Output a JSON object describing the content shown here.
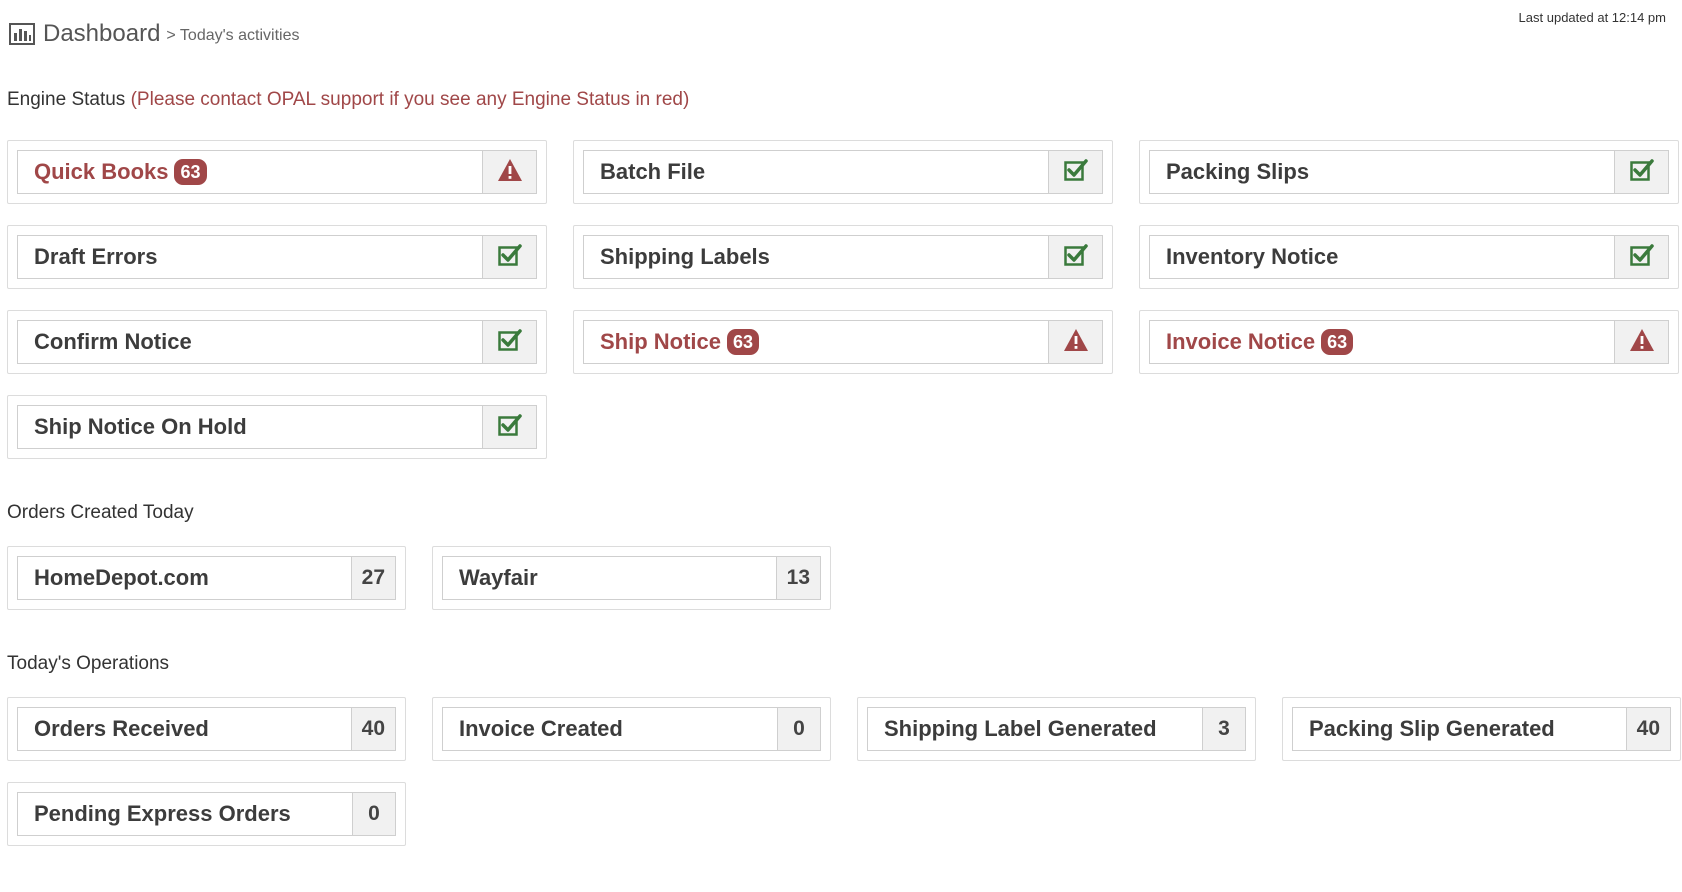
{
  "header": {
    "title": "Dashboard",
    "breadcrumb": "> Today's activities",
    "icon": "bar-chart-icon",
    "last_updated": "Last updated at 12:14 pm"
  },
  "colors": {
    "error": "#a04748",
    "ok": "#3a7a3c",
    "badge": "#a04748"
  },
  "engine_status": {
    "title": "Engine Status",
    "note": "(Please contact OPAL support if you see any Engine Status in red)",
    "items": [
      {
        "label": "Quick Books",
        "badge": "63",
        "status": "error",
        "icon": "warning-icon"
      },
      {
        "label": "Batch File",
        "badge": "",
        "status": "ok",
        "icon": "check-square-icon"
      },
      {
        "label": "Packing Slips",
        "badge": "",
        "status": "ok",
        "icon": "check-square-icon"
      },
      {
        "label": "Draft Errors",
        "badge": "",
        "status": "ok",
        "icon": "check-square-icon"
      },
      {
        "label": "Shipping Labels",
        "badge": "",
        "status": "ok",
        "icon": "check-square-icon"
      },
      {
        "label": "Inventory Notice",
        "badge": "",
        "status": "ok",
        "icon": "check-square-icon"
      },
      {
        "label": "Confirm Notice",
        "badge": "",
        "status": "ok",
        "icon": "check-square-icon"
      },
      {
        "label": "Ship Notice",
        "badge": "63",
        "status": "error",
        "icon": "warning-icon"
      },
      {
        "label": "Invoice Notice",
        "badge": "63",
        "status": "error",
        "icon": "warning-icon"
      },
      {
        "label": "Ship Notice On Hold",
        "badge": "",
        "status": "ok",
        "icon": "check-square-icon"
      }
    ]
  },
  "orders_today": {
    "title": "Orders Created Today",
    "items": [
      {
        "label": "HomeDepot.com",
        "count": "27"
      },
      {
        "label": "Wayfair",
        "count": "13"
      }
    ]
  },
  "operations": {
    "title": "Today's Operations",
    "items": [
      {
        "label": "Orders Received",
        "count": "40"
      },
      {
        "label": "Invoice Created",
        "count": "0"
      },
      {
        "label": "Shipping Label Generated",
        "count": "3"
      },
      {
        "label": "Packing Slip Generated",
        "count": "40"
      },
      {
        "label": "Pending Express Orders",
        "count": "0"
      }
    ]
  }
}
